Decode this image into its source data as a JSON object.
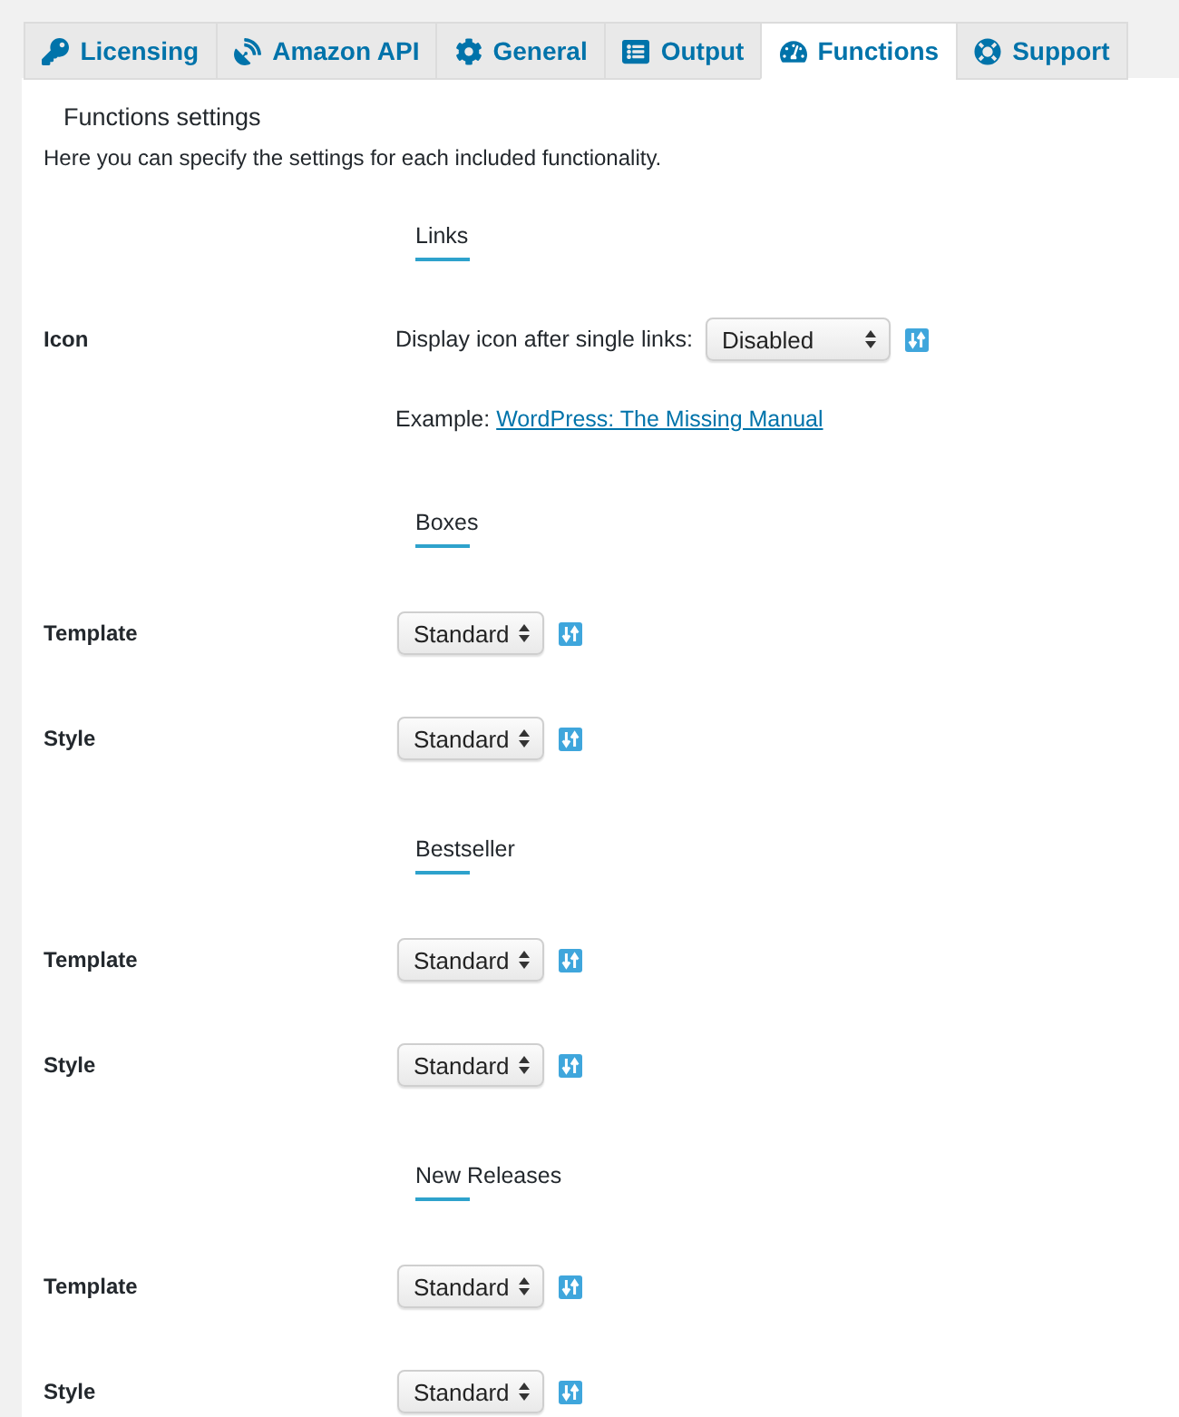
{
  "tabs": [
    {
      "label": "Licensing",
      "selected": false
    },
    {
      "label": "Amazon API",
      "selected": false
    },
    {
      "label": "General",
      "selected": false
    },
    {
      "label": "Output",
      "selected": false
    },
    {
      "label": "Functions",
      "selected": true
    },
    {
      "label": "Support",
      "selected": false
    }
  ],
  "panel": {
    "title": "Functions settings",
    "description": "Here you can specify the settings for each included functionality."
  },
  "sections": [
    {
      "heading": "Links",
      "rows": [
        {
          "kind": "select",
          "label": "Icon",
          "prompt": "Display icon after single links:",
          "value": "Disabled"
        },
        {
          "kind": "example",
          "prefix": "Example:",
          "link": "WordPress: The Missing Manual"
        }
      ]
    },
    {
      "heading": "Boxes",
      "rows": [
        {
          "kind": "select",
          "label": "Template",
          "value": "Standard"
        },
        {
          "kind": "select",
          "label": "Style",
          "value": "Standard"
        }
      ]
    },
    {
      "heading": "Bestseller",
      "rows": [
        {
          "kind": "select",
          "label": "Template",
          "value": "Standard"
        },
        {
          "kind": "select",
          "label": "Style",
          "value": "Standard"
        }
      ]
    },
    {
      "heading": "New Releases",
      "rows": [
        {
          "kind": "select",
          "label": "Template",
          "value": "Standard"
        },
        {
          "kind": "select",
          "label": "Style",
          "value": "Standard"
        }
      ]
    }
  ]
}
